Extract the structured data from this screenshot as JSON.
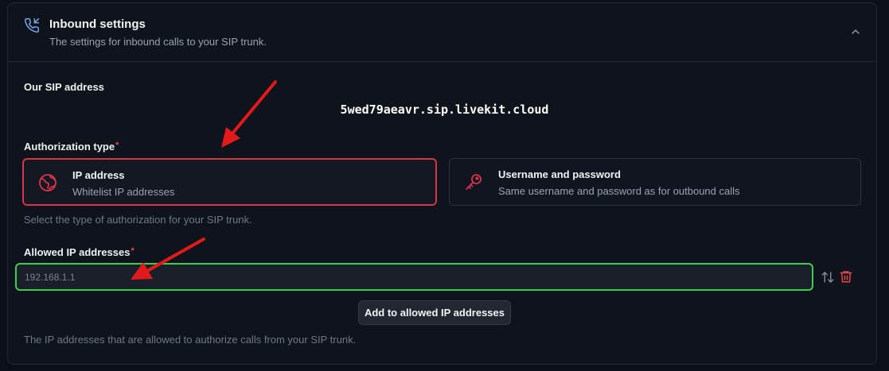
{
  "header": {
    "title": "Inbound settings",
    "description": "The settings for inbound calls to your SIP trunk."
  },
  "sip": {
    "label": "Our SIP address",
    "address": "5wed79aeavr.sip.livekit.cloud"
  },
  "auth": {
    "label": "Authorization type",
    "required_mark": "*",
    "options": [
      {
        "title": "IP address",
        "description": "Whitelist IP addresses",
        "icon": "globe-icon",
        "selected": true
      },
      {
        "title": "Username and password",
        "description": "Same username and password as for outbound calls",
        "icon": "key-icon",
        "selected": false
      }
    ],
    "help": "Select the type of authorization for your SIP trunk."
  },
  "allowed_ips": {
    "label": "Allowed IP addresses",
    "required_mark": "*",
    "placeholder": "192.168.1.1",
    "value": "",
    "add_button": "Add to allowed IP addresses",
    "help": "The IP addresses that are allowed to authorize calls from your SIP trunk."
  },
  "colors": {
    "accent_red": "#d7354a",
    "valid_green": "#3ccf4e",
    "annotation_arrow": "#e11b1b"
  }
}
